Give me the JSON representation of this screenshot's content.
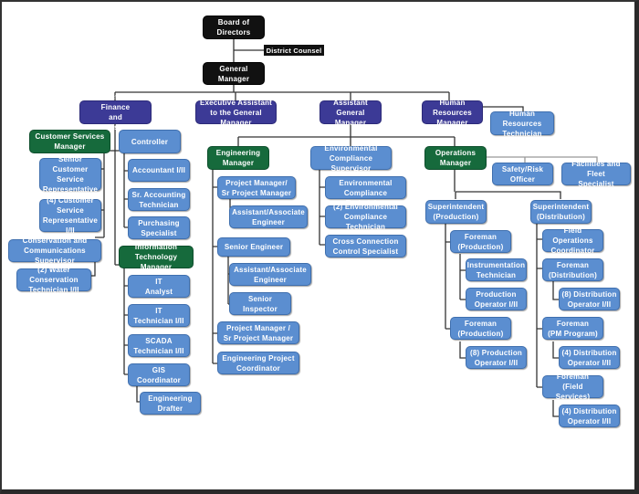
{
  "colors": {
    "executive": "#111111",
    "department_head": "#3c3a96",
    "manager": "#166a3c",
    "staff": "#5b8ed0",
    "connector": "#333333"
  },
  "nodes": {
    "board": "Board of\nDirectors",
    "district_counsel": "District Counsel",
    "general_manager": "General\nManager",
    "dir_finance": "Director of Finance\nand Administration",
    "exec_assistant": "Executive Assistant\nto the General Manager",
    "asst_gm": "Assistant\nGeneral Manager",
    "hr_manager": "Human Resources\nManager",
    "hr_technician": "Human Resources\nTechnician",
    "cs_manager": "Customer Services\nManager",
    "senior_csr": "Senior Customer\nService\nRepresentative",
    "csr": "(4) Customer\nService\nRepresentative I/II",
    "conservation_supervisor": "Conservation and\nCommunications Supervisor",
    "water_conservation_tech": "(2) Water Conservation\nTechnician I/II",
    "controller": "Controller",
    "accountant": "Accountant I/II",
    "sr_accounting_tech": "Sr. Accounting\nTechnician",
    "purchasing": "Purchasing\nSpecialist",
    "it_manager": "Information\nTechnology Manager",
    "it_analyst": "IT\nAnalyst",
    "it_technician": "IT\nTechnician I/II",
    "scada_technician": "SCADA\nTechnician I/II",
    "gis_coordinator": "GIS\nCoordinator",
    "engineering_drafter": "Engineering\nDrafter",
    "engineering_manager": "Engineering\nManager",
    "project_manager_1": "Project Manager/\nSr Project Manager",
    "assoc_engineer_1": "Assistant/Associate\nEngineer",
    "senior_engineer": "Senior Engineer",
    "assoc_engineer_2": "Assistant/Associate\nEngineer",
    "senior_inspector": "Senior\nInspector",
    "project_manager_2": "Project Manager /\nSr Project Manager",
    "eng_project_coordinator": "Engineering Project\nCoordinator",
    "env_supervisor": "Environmental\nCompliance Supervisor",
    "sr_env_tech": "Senior Environmental\nCompliance Technician",
    "env_tech": "(2) Environmental\nCompliance Technician",
    "cross_connection": "Cross Connection\nControl Specialist",
    "operations_manager": "Operations\nManager",
    "safety_officer": "Safety/Risk\nOfficer",
    "facilities_specialist": "Facilities and Fleet\nSpecialist",
    "supt_production": "Superintendent\n(Production)",
    "foreman_production_1": "Foreman\n(Production)",
    "instrumentation_tech": "Instrumentation\nTechnician",
    "production_operator": "Production\nOperator I/II",
    "foreman_production_2": "Foreman\n(Production)",
    "production_operator_8": "(8) Production\nOperator I/II",
    "supt_distribution": "Superintendent\n(Distribution)",
    "field_ops_coordinator": "Field Operations\nCoordinator",
    "foreman_distribution": "Foreman\n(Distribution)",
    "dist_operator_8": "(8) Distribution\nOperator I/II",
    "foreman_pm": "Foreman\n(PM Program)",
    "dist_operator_4a": "(4) Distribution\nOperator I/II",
    "foreman_field": "Foreman\n(Field Services)",
    "dist_operator_4b": "(4) Distribution\nOperator I/II"
  }
}
